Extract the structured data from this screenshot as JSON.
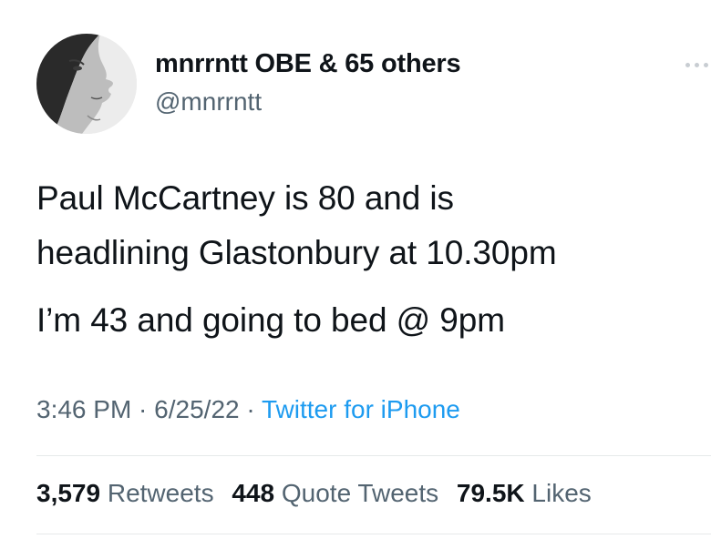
{
  "author": {
    "display_name": "mnrrntt OBE & 65 others",
    "handle": "@mnrrntt",
    "avatar_icon": "profile-face-illusion-avatar"
  },
  "more_icon": "more-horizontal-icon",
  "tweet": {
    "lines": [
      "Paul McCartney is 80 and is",
      "headlining Glastonbury at 10.30pm",
      "I’m 43 and going to bed @ 9pm"
    ]
  },
  "meta": {
    "time": "3:46 PM",
    "sep1": " · ",
    "date": "6/25/22",
    "sep2": " · ",
    "source": "Twitter for iPhone"
  },
  "stats": {
    "retweets_count": "3,579",
    "retweets_label": "Retweets",
    "quotes_count": "448",
    "quotes_label": "Quote Tweets",
    "likes_count": "79.5K",
    "likes_label": "Likes"
  },
  "colors": {
    "text": "#0f1419",
    "secondary": "#536471",
    "link": "#1d9bf0",
    "divider": "#e6e9ea"
  }
}
